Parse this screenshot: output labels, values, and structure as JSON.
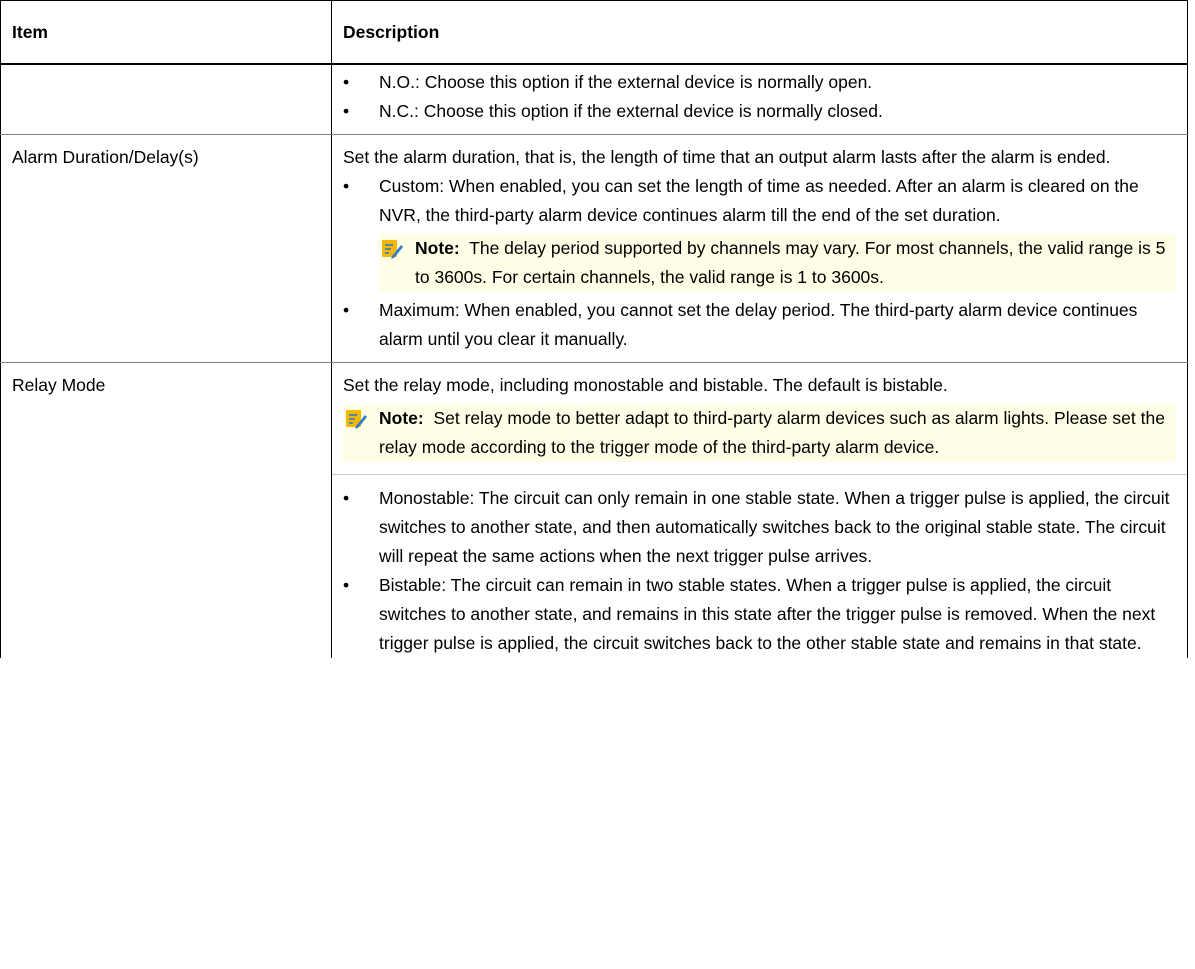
{
  "table": {
    "headers": {
      "item": "Item",
      "description": "Description"
    },
    "rows": [
      {
        "item": "",
        "bullets": [
          "N.O.: Choose this option if the external device is normally open.",
          "N.C.: Choose this option if the external device is normally closed."
        ]
      },
      {
        "item": "Alarm Duration/Delay(s)",
        "intro": "Set the alarm duration, that is, the length of time that an output alarm lasts after the alarm is ended.",
        "bullets": [
          "Custom: When enabled, you can set the length of time as needed. After an alarm is cleared on the NVR, the third-party alarm device continues alarm till the end of the set duration.",
          "Maximum: When enabled, you cannot set the delay period. The third-party alarm device continues alarm until you clear it manually."
        ],
        "note": {
          "label": "Note:",
          "text": "The delay period supported by channels may vary. For most channels, the valid range is 5 to 3600s. For certain channels, the valid range is 1 to 3600s."
        }
      },
      {
        "item": "Relay Mode",
        "intro": "Set the relay mode, including monostable and bistable. The default is bistable.",
        "note": {
          "label": "Note:",
          "text": "Set relay mode to better adapt to third-party alarm devices such as alarm lights. Please set the relay mode according to the trigger mode of the third-party alarm device."
        },
        "bullets": [
          "Monostable: The circuit can only remain in one stable state. When a trigger pulse is applied, the circuit switches to another state, and then automatically switches back to the original stable state. The circuit will repeat the same actions when the next trigger pulse arrives.",
          "Bistable: The circuit can remain in two stable states. When a trigger pulse is applied, the circuit switches to another state, and remains in this state after the trigger pulse is removed. When the next trigger pulse is applied, the circuit switches back to the other stable state and remains in that state."
        ]
      }
    ]
  },
  "bullet_glyph": "•",
  "note_icon": "note-pencil-icon",
  "colors": {
    "note_background": "#fefee7",
    "note_icon_fill": "#f5b800",
    "note_icon_stroke": "#2e7dd1"
  }
}
